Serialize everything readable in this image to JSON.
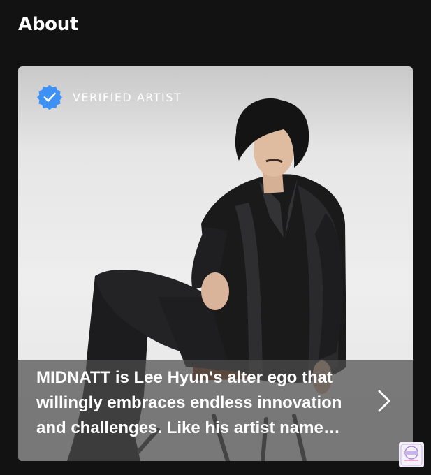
{
  "section": {
    "title": "About"
  },
  "card": {
    "verified_label": "VERIFIED ARTIST",
    "bio": "MIDNATT is Lee Hyun's alter ego that willingly embraces endless innovation and challenges. Like his artist name MI...",
    "verified_icon": "verified-check-icon",
    "chevron_icon": "chevron-right-icon"
  },
  "colors": {
    "background": "#121212",
    "verified_blue": "#3d91f4",
    "text": "#ffffff"
  }
}
